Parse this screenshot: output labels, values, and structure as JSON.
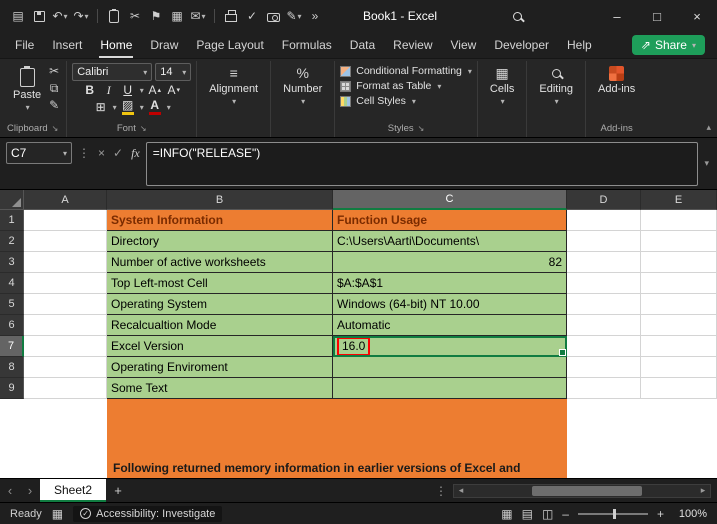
{
  "titlebar": {
    "title": "Book1 - Excel"
  },
  "ribbon_tabs": {
    "items": [
      "File",
      "Insert",
      "Home",
      "Draw",
      "Page Layout",
      "Formulas",
      "Data",
      "Review",
      "View",
      "Developer",
      "Help"
    ],
    "active": "Home",
    "share": "Share"
  },
  "ribbon": {
    "clipboard": {
      "paste": "Paste",
      "group": "Clipboard"
    },
    "font": {
      "family": "Calibri",
      "size": "14",
      "bold": "B",
      "italic": "I",
      "underline": "U",
      "group": "Font"
    },
    "alignment": {
      "label": "Alignment"
    },
    "number": {
      "label": "Number"
    },
    "styles": {
      "items": [
        "Conditional Formatting",
        "Format as Table",
        "Cell Styles"
      ],
      "group": "Styles"
    },
    "cells": {
      "label": "Cells"
    },
    "editing": {
      "label": "Editing"
    },
    "addins": {
      "label": "Add-ins",
      "group": "Add-ins"
    }
  },
  "formula_bar": {
    "name_box": "C7",
    "fx": "fx",
    "formula": "=INFO(\"RELEASE\")"
  },
  "grid": {
    "columns": [
      "A",
      "B",
      "C",
      "D",
      "E"
    ],
    "rows": [
      {
        "n": "1",
        "b": "System Information",
        "c": "Function Usage"
      },
      {
        "n": "2",
        "b": "Directory",
        "c": "C:\\Users\\Aarti\\Documents\\"
      },
      {
        "n": "3",
        "b": "Number of active worksheets",
        "c": "82"
      },
      {
        "n": "4",
        "b": "Top Left-most Cell",
        "c": "$A:$A$1"
      },
      {
        "n": "5",
        "b": "Operating System",
        "c": "Windows (64-bit) NT 10.00"
      },
      {
        "n": "6",
        "b": "Recalcualtion Mode",
        "c": "Automatic"
      },
      {
        "n": "7",
        "b": "Excel Version",
        "c": "16.0"
      },
      {
        "n": "8",
        "b": "Operating Enviroment",
        "c": ""
      },
      {
        "n": "9",
        "b": "Some Text",
        "c": ""
      }
    ],
    "note": "Following returned memory information in earlier versions of Excel and"
  },
  "sheetbar": {
    "tab": "Sheet2"
  },
  "statusbar": {
    "mode": "Ready",
    "accessibility": "Accessibility: Investigate",
    "zoom": "100%"
  },
  "colors": {
    "header_fill_orange": "#ED7D31",
    "cell_fill_green": "#A9D08E",
    "selection_green": "#107C41",
    "value_highlight_red": "#FF0000",
    "share_button_green": "#1E9E5A"
  }
}
